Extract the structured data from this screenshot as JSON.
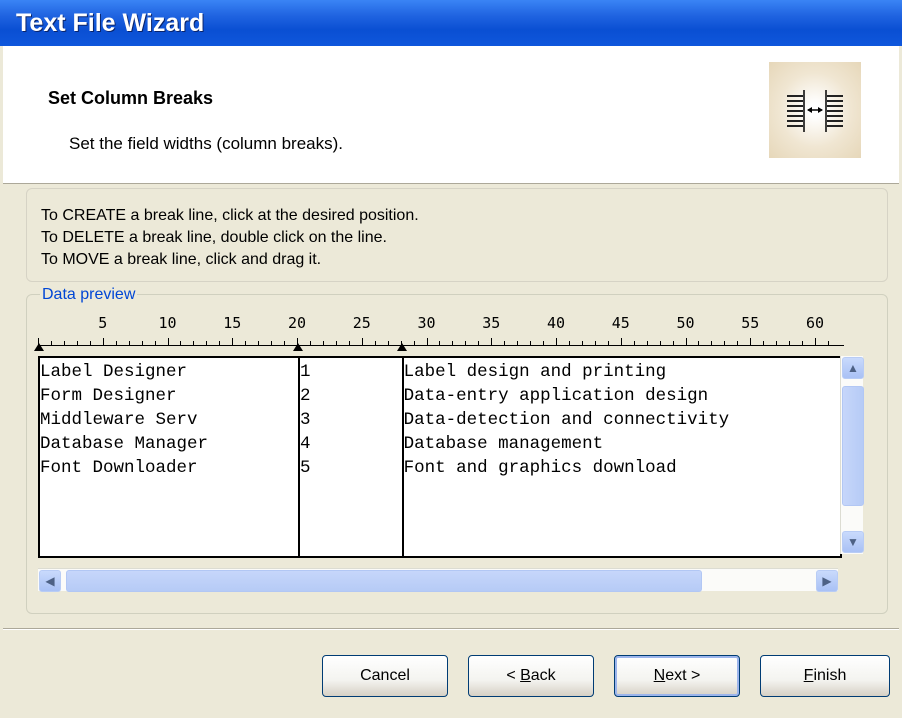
{
  "window": {
    "title": "Text File Wizard"
  },
  "header": {
    "title": "Set Column Breaks",
    "subtitle": "Set the field widths (column breaks).",
    "icon": "column-break-icon"
  },
  "instructions": [
    "To CREATE a break line, click at the desired position.",
    "To DELETE a break line, double click on the line.",
    "To MOVE a break line, click and drag it."
  ],
  "preview": {
    "group_label": "Data preview",
    "ruler_labels": [
      "5",
      "10",
      "15",
      "20",
      "25",
      "30",
      "35",
      "40",
      "45",
      "50",
      "55",
      "60"
    ],
    "break_positions": [
      0,
      20,
      28
    ],
    "rows": [
      [
        "Label Designer",
        "1",
        "Label design and printing"
      ],
      [
        "Form Designer",
        "2",
        "Data-entry application design"
      ],
      [
        "Middleware Serv",
        "3",
        "Data-detection and connectivity"
      ],
      [
        "Database Manager",
        "4",
        "Database management"
      ],
      [
        "Font Downloader",
        "5",
        "Font and graphics download"
      ]
    ]
  },
  "buttons": {
    "cancel": "Cancel",
    "back_pre": "< ",
    "back_key": "B",
    "back_post": "ack",
    "next_key": "N",
    "next_post": "ext >",
    "finish_key": "F",
    "finish_post": "inish"
  }
}
